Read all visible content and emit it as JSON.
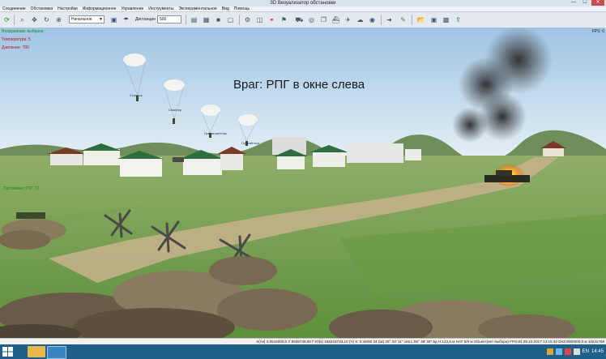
{
  "window": {
    "title": "3D Визуализатор обстановки",
    "min": "—",
    "max": "☐",
    "close": "✕"
  },
  "menu": [
    "Соединение",
    "Обстановка",
    "Настройки",
    "Информационное",
    "Управление",
    "Инструменты",
    "Экспериментальное",
    "Вид",
    "Помощь"
  ],
  "toolbar": {
    "mode_select": "Начальное",
    "distance_label": "Дистанция",
    "distance_value": "500"
  },
  "fps": "FPS: 0",
  "hud": {
    "line1": "Вооружение: выбрано",
    "line2": "Температура: 5",
    "line3": "Давление: 780",
    "tag": "Противник: РПГ 72"
  },
  "caption": "Враг: РПГ в окне слева",
  "labels": {
    "parachutists": [
      "Стрелок",
      "Снайпер",
      "Гранатомётчик",
      "Пулемётчик"
    ]
  },
  "status": "X(Ак) 4,5519000,0 У 5836749,80  Г-Ю(к) 168318733,10  (Ч) Х: 5:46/60 24  (Ш) 26° 33' 11\"  сев  L:65° 49' 34\" вд  Н:123,6 м  НАТ 5/6 м  Объект(нет выбора)  FPS:84  09.10.2017 14:15:32  Dist:0000000,0 м  1024x768",
  "taskbar": {
    "lang": "EN",
    "time": "14:45"
  },
  "colors": {
    "caption": "#1a1a1a",
    "hud_green": "#1a8a1a",
    "hud_red": "#c01818",
    "taskbar": "#1f5f8a"
  }
}
